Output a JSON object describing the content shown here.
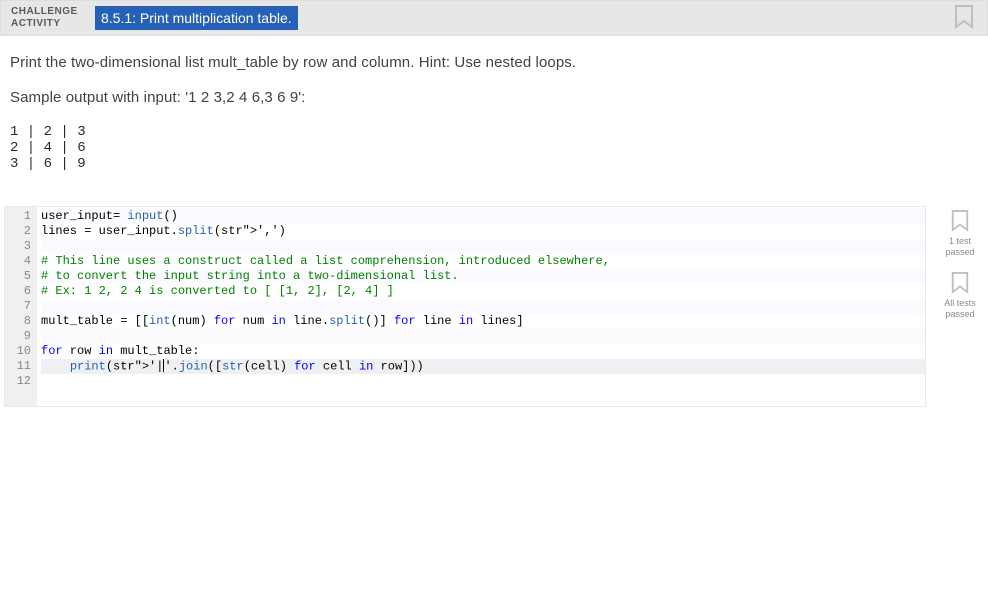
{
  "header": {
    "challenge_label_line1": "CHALLENGE",
    "challenge_label_line2": "ACTIVITY",
    "title": "8.5.1: Print multiplication table."
  },
  "prompt": {
    "intro": "Print the two-dimensional list mult_table by row and column. Hint: Use nested loops.",
    "sample_label": "Sample output with input: '1 2 3,2 4 6,3 6 9':",
    "sample_output": "1 | 2 | 3\n2 | 4 | 6\n3 | 6 | 9"
  },
  "code": {
    "lines": [
      "user_input= input()",
      "lines = user_input.split(',')",
      "",
      "# This line uses a construct called a list comprehension, introduced elsewhere,",
      "# to convert the input string into a two-dimensional list.",
      "# Ex: 1 2, 2 4 is converted to [ [1, 2], [2, 4] ]",
      "",
      "mult_table = [[int(num) for num in line.split()] for line in lines]",
      "",
      "for row in mult_table:",
      "    print('|'.join([str(cell) for cell in row]))",
      ""
    ],
    "highlight_line_index": 10
  },
  "tests": {
    "one_passed": "1 test\npassed",
    "all_passed": "All tests\npassed"
  }
}
